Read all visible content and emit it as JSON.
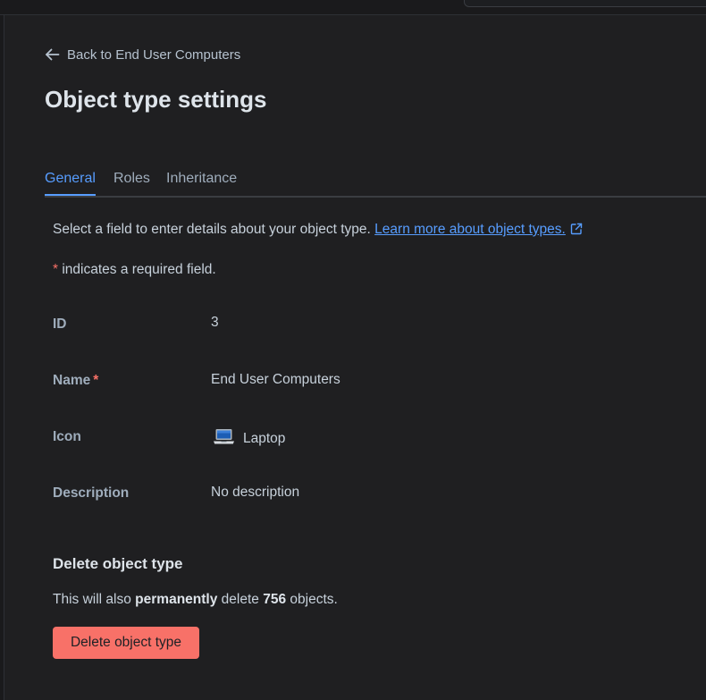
{
  "back_link": {
    "label": "Back to End User Computers",
    "icon": "arrow-left-icon"
  },
  "page_title": "Object type settings",
  "tabs": [
    {
      "label": "General",
      "active": true
    },
    {
      "label": "Roles",
      "active": false
    },
    {
      "label": "Inheritance",
      "active": false
    }
  ],
  "intro": {
    "text": "Select a field to enter details about your object type.",
    "link_label": "Learn more about object types.",
    "link_icon": "external-link-icon"
  },
  "required_note": {
    "star": "*",
    "text": "indicates a required field."
  },
  "fields": {
    "id": {
      "label": "ID",
      "value": "3"
    },
    "name": {
      "label": "Name",
      "required_star": "*",
      "value": "End User Computers"
    },
    "icon": {
      "label": "Icon",
      "value": "Laptop",
      "icon": "laptop-icon"
    },
    "description": {
      "label": "Description",
      "value": "No description"
    }
  },
  "delete_section": {
    "heading": "Delete object type",
    "text_before": "This will also",
    "text_bold": "permanently",
    "text_middle": "delete",
    "count": "756",
    "text_after": "objects.",
    "button_label": "Delete object type"
  },
  "colors": {
    "background": "#1f1f21",
    "accent": "#579dff",
    "danger": "#f87168"
  }
}
